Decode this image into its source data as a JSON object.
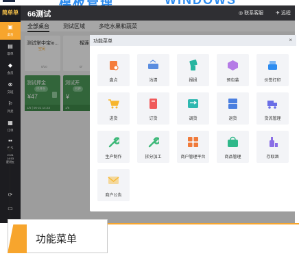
{
  "header": {
    "store_name": "66测试",
    "service_label": "联系客服",
    "remote_label": "远程"
  },
  "top_caption": {
    "title": "模板管理",
    "title_en": "WINDOWS"
  },
  "sidebar": {
    "brand": "简单单",
    "items": [
      {
        "label": "桌台",
        "icon": "table-icon"
      },
      {
        "label": "取单",
        "icon": "receipt-icon"
      },
      {
        "label": "会员",
        "icon": "member-icon"
      },
      {
        "label": "交班",
        "icon": "shift-icon"
      },
      {
        "label": "外卖",
        "icon": "delivery-icon"
      },
      {
        "label": "订单",
        "icon": "order-icon"
      },
      {
        "label": "更多",
        "icon": "more-icon"
      }
    ],
    "clock": [
      "2024",
      "14:53",
      "星期五"
    ]
  },
  "tabs": [
    {
      "label": "全部桌台",
      "active": true
    },
    {
      "label": "测试区域",
      "active": false
    },
    {
      "label": "多吃水果和蔬菜",
      "active": false
    }
  ],
  "cards": [
    {
      "title": "测试掌中宝io...",
      "status": "空闲",
      "footer": "0/10",
      "type": "idle"
    },
    {
      "title": "榴莲",
      "status": "",
      "footer": "0/",
      "type": "idle"
    },
    {
      "title": "测试押金",
      "badge": "已开台",
      "price": "¥47",
      "footer": "1/6 | 06-21 14:23",
      "type": "busy"
    },
    {
      "title": "测试开",
      "badge": "已开",
      "price": "¥",
      "footer": "1/6",
      "type": "busy"
    }
  ],
  "modal": {
    "title": "功能菜单",
    "close": "×",
    "items": [
      {
        "label": "盘点",
        "icon": "inventory-check-icon",
        "color": "#f57c3a"
      },
      {
        "label": "沽清",
        "icon": "sold-out-icon",
        "color": "#5a8de0"
      },
      {
        "label": "报损",
        "icon": "loss-report-icon",
        "color": "#26b5a0"
      },
      {
        "label": "预包装",
        "icon": "prepack-icon",
        "color": "#b57be6"
      },
      {
        "label": "价签打印",
        "icon": "price-tag-print-icon",
        "color": "#2d8cf0"
      },
      {
        "label": "进货",
        "icon": "purchase-cart-icon",
        "color": "#f7b52d"
      },
      {
        "label": "订货",
        "icon": "order-goods-icon",
        "color": "#f05a5a"
      },
      {
        "label": "调货",
        "icon": "transfer-icon",
        "color": "#2fb8b0"
      },
      {
        "label": "退货",
        "icon": "return-icon",
        "color": "#4a7fe0"
      },
      {
        "label": "货流管理",
        "icon": "logistics-truck-icon",
        "color": "#6a6ee6"
      },
      {
        "label": "生产制作",
        "icon": "production-wrench-icon",
        "color": "#3cb878"
      },
      {
        "label": "拆分加工",
        "icon": "split-wrench-icon",
        "color": "#3cb878"
      },
      {
        "label": "商户管理平台",
        "icon": "merchant-platform-icon",
        "color": "#f07a3a"
      },
      {
        "label": "商品管理",
        "icon": "goods-manage-icon",
        "color": "#2fb88a"
      },
      {
        "label": "存取酒",
        "icon": "wine-storage-icon",
        "color": "#8a6ee6"
      },
      {
        "label": "商户公告",
        "icon": "announcement-icon",
        "color": "#f7b52d"
      }
    ]
  },
  "callout": {
    "label": "功能菜单"
  }
}
